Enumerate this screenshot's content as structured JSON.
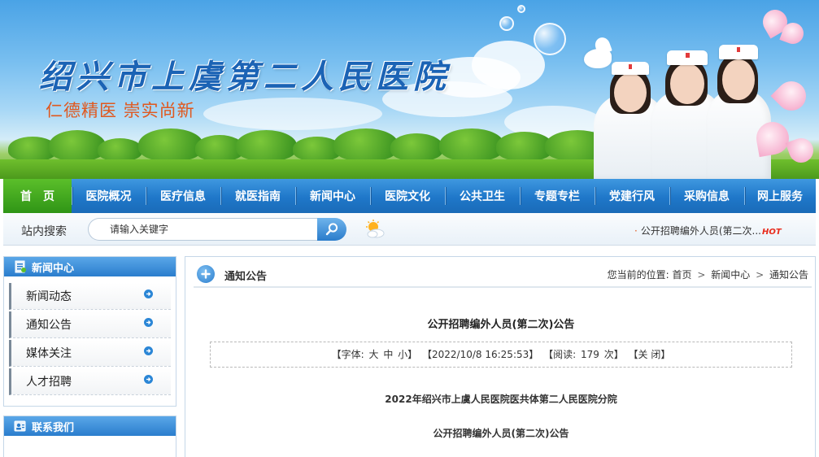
{
  "site": {
    "title": "绍兴市上虞第二人民医院",
    "slogan": "仁德精医 崇实尚新"
  },
  "nav": {
    "items": [
      {
        "label": "首　页",
        "active": true
      },
      {
        "label": "医院概况"
      },
      {
        "label": "医疗信息"
      },
      {
        "label": "就医指南"
      },
      {
        "label": "新闻中心"
      },
      {
        "label": "医院文化"
      },
      {
        "label": "公共卫生"
      },
      {
        "label": "专题专栏"
      },
      {
        "label": "党建行风"
      },
      {
        "label": "采购信息"
      },
      {
        "label": "网上服务"
      }
    ]
  },
  "search": {
    "label": "站内搜索",
    "placeholder": "请输入关键字"
  },
  "ticker": {
    "text": "公开招聘编外人员(第二次...",
    "badge": "HOT"
  },
  "sidebar": {
    "news_title": "新闻中心",
    "items": [
      {
        "label": "新闻动态"
      },
      {
        "label": "通知公告"
      },
      {
        "label": "媒体关注"
      },
      {
        "label": "人才招聘"
      }
    ],
    "contact_title": "联系我们"
  },
  "content": {
    "section_title": "通知公告",
    "breadcrumb": {
      "prefix": "您当前的位置:",
      "home": "首页",
      "sep": ">",
      "level1": "新闻中心",
      "level2": "通知公告"
    },
    "article": {
      "title": "公开招聘编外人员(第二次)公告",
      "meta": {
        "font_label": "【字体:",
        "font_big": "大",
        "font_mid": "中",
        "font_small": "小】",
        "date": "【2022/10/8 16:25:53】",
        "reads_label": "【阅读:",
        "reads": "179",
        "reads_unit": "次】",
        "close": "【关 闭】"
      },
      "para1": "2022年绍兴市上虞人民医院医共体第二人民医院分院",
      "para2": "公开招聘编外人员(第二次)公告"
    }
  },
  "colors": {
    "nav_blue": "#1f77c9",
    "nav_active_green": "#2f9516",
    "title_blue": "#1b63b5",
    "slogan_orange": "#e0581e",
    "hot_red": "#e82b1c"
  }
}
